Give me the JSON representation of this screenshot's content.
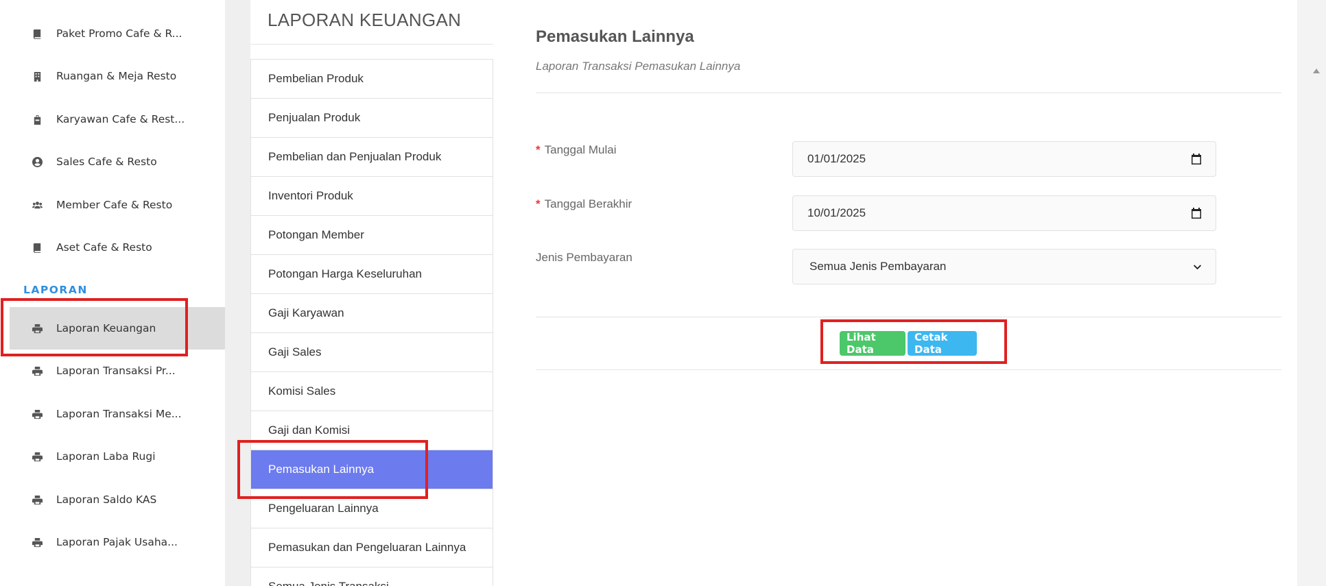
{
  "sidebar": {
    "items_top": [
      {
        "label": "Paket Promo Cafe & R...",
        "icon": "book-icon"
      },
      {
        "label": "Ruangan & Meja Resto",
        "icon": "building-icon"
      },
      {
        "label": "Karyawan Cafe & Rest...",
        "icon": "briefcase-icon"
      },
      {
        "label": "Sales Cafe & Resto",
        "icon": "user-circle-icon"
      },
      {
        "label": "Member Cafe & Resto",
        "icon": "users-icon"
      },
      {
        "label": "Aset Cafe & Resto",
        "icon": "book-icon"
      }
    ],
    "heading": "LAPORAN",
    "items_report": [
      {
        "label": "Laporan Keuangan",
        "icon": "printer-icon",
        "active": true
      },
      {
        "label": "Laporan Transaksi Pr...",
        "icon": "printer-icon"
      },
      {
        "label": "Laporan Transaksi Me...",
        "icon": "printer-icon"
      },
      {
        "label": "Laporan Laba Rugi",
        "icon": "printer-icon"
      },
      {
        "label": "Laporan Saldo KAS",
        "icon": "printer-icon"
      },
      {
        "label": "Laporan Pajak Usaha...",
        "icon": "printer-icon"
      }
    ]
  },
  "report_menu": {
    "title": "LAPORAN KEUANGAN",
    "items": [
      "Pembelian Produk",
      "Penjualan Produk",
      "Pembelian dan Penjualan Produk",
      "Inventori Produk",
      "Potongan Member",
      "Potongan Harga Keseluruhan",
      "Gaji Karyawan",
      "Gaji Sales",
      "Komisi Sales",
      "Gaji dan Komisi",
      "Pemasukan Lainnya",
      "Pengeluaran Lainnya",
      "Pemasukan dan Pengeluaran Lainnya",
      "Semua Jenis Transaksi"
    ],
    "active_item": "Pemasukan Lainnya"
  },
  "form": {
    "title": "Pemasukan Lainnya",
    "subtitle": "Laporan Transaksi Pemasukan Lainnya",
    "required_mark": "*",
    "start_date": {
      "label": "Tanggal Mulai",
      "value": "01/01/2025"
    },
    "end_date": {
      "label": "Tanggal Berakhir",
      "value": "10/01/2025"
    },
    "payment_type": {
      "label": "Jenis Pembayaran",
      "value": "Semua Jenis Pembayaran"
    },
    "view_button": "Lihat Data",
    "print_button": "Cetak Data"
  },
  "colors": {
    "active_menu": "#6c7bee",
    "view_button": "#4cc76a",
    "print_button": "#3db7f0",
    "sidebar_heading": "#2f8fe0",
    "annotation": "#e02020"
  }
}
